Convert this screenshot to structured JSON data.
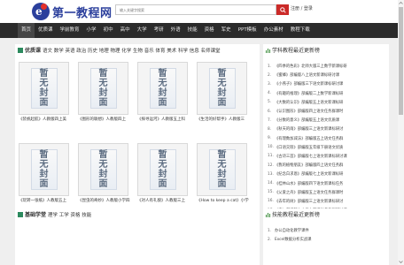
{
  "header": {
    "logo_text": "第一教程网",
    "search_placeholder": "输入关键字搜索",
    "login_label": "注册 / 登录"
  },
  "nav": {
    "items": [
      "首页",
      "优质课",
      "学前教育",
      "小学",
      "初中",
      "高中",
      "大学",
      "考研",
      "外语",
      "技能",
      "资格",
      "军史",
      "PPT模板",
      "办公素材",
      "教程下载"
    ],
    "active_index": 0
  },
  "section1": {
    "title": "优质课",
    "links": "语文 数学 英语 政治 历史 地理 物理 化学 生物 音乐 体育 美术 科学 信息 名师课堂",
    "placeholder_text": [
      "暂",
      "无",
      "封",
      "面"
    ],
    "cards": [
      "《装帆起航》人教版四上美",
      "《图形的联想》人教版四上",
      "《探寻运河》人教版五上科",
      "《生活的好帮手》人教版三",
      "《玩转一张纸》人教版五上",
      "《昆虫的奇妙》人教版小学四",
      "《对人有礼貌》人教版三上",
      "《How to keep a cat》小学"
    ]
  },
  "latest1": {
    "title": "学科教程最近更新榜",
    "items": [
      "《四季的色彩》北师大版三上数学新课标研",
      "《蜜蜂》部编版八上语文新课标研讨课",
      "《小燕子》部编版三下语文新课标研讨课",
      "《有趣的推理》部编版二上数学新课标研",
      "《大数的认识》部编版五上语文新课标研",
      "《认识图形》部编版四上语文任务群课时",
      "《分数的意义》部编版五上语文优质课",
      "《秋天的雨》部编版三上语文新课标研讨",
      "《有理数加减法》部编版五上语文任务群",
      "《口语交际》部编版五年级下册语文优质",
      "《古诗三首》部编版七上语文新课标研讨课",
      "《我的植物朋友》部编版四上语文任务群",
      "《纪念白求恩》部编版七上语文新课标研",
      "《桂林山水》部编版四下语文新课标任务",
      "《父爱之舟》部编版五上语文任务群课时",
      "《去年的树》部编版三上语文新课标研讨",
      "《春》部编版七上语文新课标任务群研讨课"
    ]
  },
  "section2": {
    "title": "基础学堂",
    "links": "理学 工学 资格 技能"
  },
  "latest2": {
    "title": "技能教程最近更新榜",
    "items": [
      "办公自动化教学课件",
      "Excel数据分析实战课"
    ]
  },
  "colors": {
    "brand_blue": "#2b3f9c",
    "brand_red": "#cb2a28",
    "nav_bg": "#2b2b2b",
    "section_icon_green": "#2c8a5e"
  },
  "icons": {
    "search": "search-icon",
    "section": "square-icon",
    "ranking": "bar-chart-icon"
  }
}
